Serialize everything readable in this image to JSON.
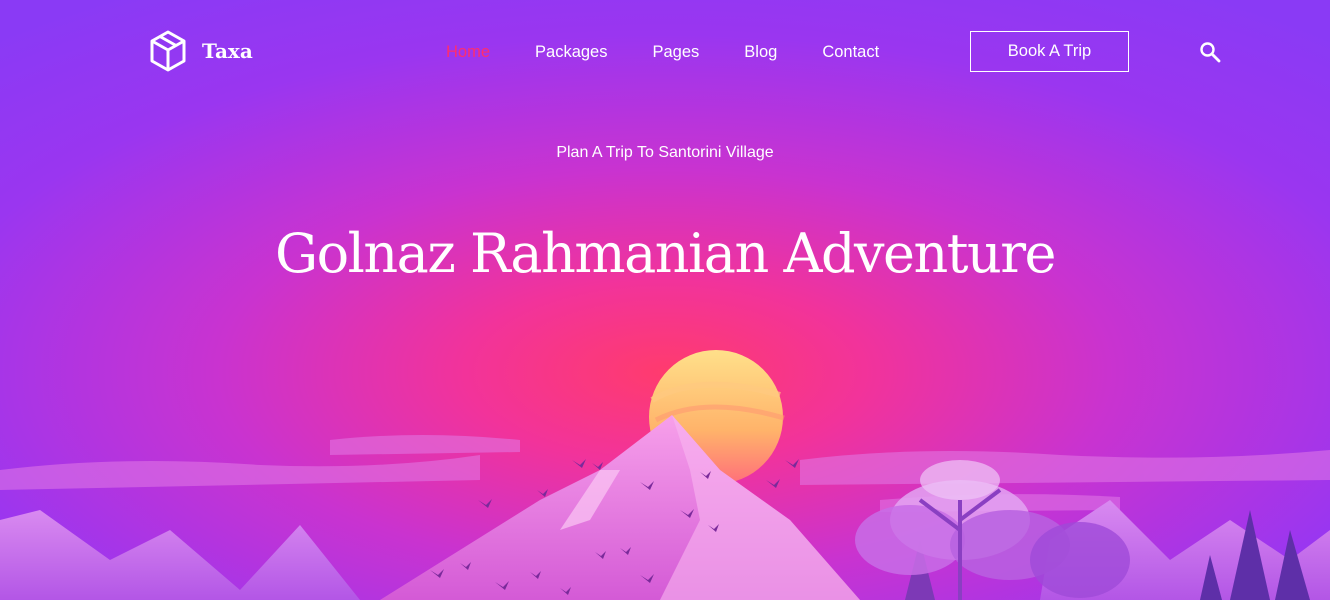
{
  "brand": {
    "name": "Taxa",
    "icon": "cube-icon"
  },
  "nav": {
    "items": [
      {
        "label": "Home",
        "active": true
      },
      {
        "label": "Packages",
        "active": false
      },
      {
        "label": "Pages",
        "active": false
      },
      {
        "label": "Blog",
        "active": false
      },
      {
        "label": "Contact",
        "active": false
      }
    ],
    "cta_label": "Book A Trip",
    "search_icon": "search-icon",
    "active_color": "#ff2d6e"
  },
  "hero": {
    "subtitle": "Plan A Trip To Santorini Village",
    "title": "Golnaz Rahmanian Adventure"
  },
  "colors": {
    "background_edge": "#8a3af5",
    "background_glow": "#ff3b6e",
    "sun": "#ffd77a",
    "mountain": "#e86ad8"
  }
}
